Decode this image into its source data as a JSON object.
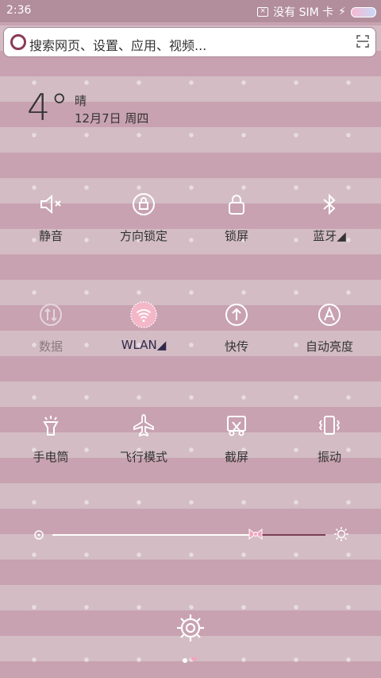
{
  "status_bar": {
    "time": "2:36",
    "sim_text": "没有 SIM 卡"
  },
  "search": {
    "placeholder": "搜索网页、设置、应用、视频..."
  },
  "weather": {
    "temperature": "4°",
    "condition": "晴",
    "date": "12月7日 周四"
  },
  "tiles": [
    {
      "label": "静音",
      "icon": "mute-icon"
    },
    {
      "label": "方向锁定",
      "icon": "rotation-lock-icon"
    },
    {
      "label": "锁屏",
      "icon": "lock-icon"
    },
    {
      "label": "蓝牙◢",
      "icon": "bluetooth-icon"
    },
    {
      "label": "数据",
      "icon": "mobile-data-icon"
    },
    {
      "label": "WLAN◢",
      "icon": "wifi-icon"
    },
    {
      "label": "快传",
      "icon": "quick-transfer-icon"
    },
    {
      "label": "自动亮度",
      "icon": "auto-brightness-icon"
    },
    {
      "label": "手电筒",
      "icon": "flashlight-icon"
    },
    {
      "label": "飞行模式",
      "icon": "airplane-icon"
    },
    {
      "label": "截屏",
      "icon": "screenshot-icon"
    },
    {
      "label": "振动",
      "icon": "vibrate-icon"
    }
  ],
  "brightness": {
    "level": 0.67
  },
  "colors": {
    "accent": "#c8a2b0",
    "wifi_active": "#f4b7c8",
    "slider_fill": "#7a3f52"
  }
}
